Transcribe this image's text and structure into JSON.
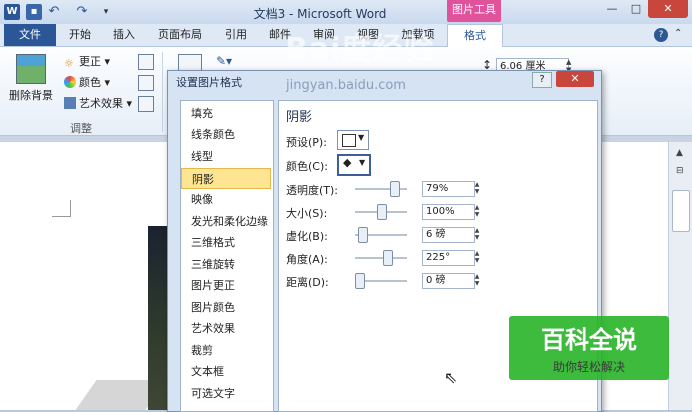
{
  "titlebar": {
    "title": "文档3 - Microsoft Word",
    "context_group": "图片工具",
    "icons": [
      "word-logo",
      "save-icon",
      "undo-icon",
      "redo-icon",
      "qat-more-icon"
    ]
  },
  "tabs": {
    "file": "文件",
    "items": [
      "开始",
      "插入",
      "页面布局",
      "引用",
      "邮件",
      "审阅",
      "视图",
      "加载项",
      "格式"
    ],
    "active": "格式"
  },
  "ribbon": {
    "remove_background": "删除背景",
    "corrections": "更正",
    "color": "颜色",
    "artistic_effects": "艺术效果",
    "adjust_group": "调整",
    "size_value": "6.06 厘米"
  },
  "dialog": {
    "title": "设置图片格式",
    "help": "?",
    "close": "✕",
    "nav": [
      "填充",
      "线条颜色",
      "线型",
      "阴影",
      "映像",
      "发光和柔化边缘",
      "三维格式",
      "三维旋转",
      "图片更正",
      "图片颜色",
      "艺术效果",
      "裁剪",
      "文本框",
      "可选文字"
    ],
    "selected": "阴影",
    "panel": {
      "title": "阴影",
      "preset_label": "预设(P):",
      "color_label": "颜色(C):",
      "rows": [
        {
          "label": "透明度(T):",
          "value": "79%",
          "level": 0.79
        },
        {
          "label": "大小(S):",
          "value": "100%",
          "level": 0.5
        },
        {
          "label": "虚化(B):",
          "value": "6 磅",
          "level": 0.06
        },
        {
          "label": "角度(A):",
          "value": "225°",
          "level": 0.625
        },
        {
          "label": "距离(D):",
          "value": "0 磅",
          "level": 0.0
        }
      ]
    }
  },
  "watermark": {
    "top": "Bai度经验",
    "url": "jingyan.baidu.com",
    "badge_title": "百科全说",
    "badge_sub": "助你轻松解决"
  }
}
